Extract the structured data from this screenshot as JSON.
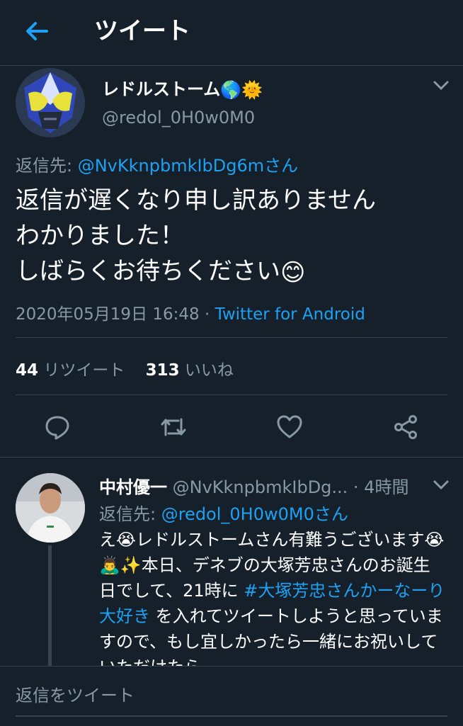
{
  "header": {
    "title": "ツイート"
  },
  "tweet": {
    "display_name": "レドルストーム",
    "name_emoji_1": "🌎",
    "name_emoji_2": "🌞",
    "handle": "@redol_0H0w0M0",
    "reply_label": "返信先: ",
    "reply_to": "@NvKknpbmkIbDg6mさん",
    "body_line1": "返信が遅くなり申し訳ありません",
    "body_line2": "わかりました！",
    "body_line3": "しばらくお待ちください",
    "body_emoji": "😊",
    "timestamp": "2020年05月19日 16:48",
    "separator": " · ",
    "source": "Twitter for Android",
    "retweet_count": "44",
    "retweet_label": " リツイート",
    "like_count": "313",
    "like_label": " いいね"
  },
  "reply": {
    "display_name": "中村優一",
    "handle": " @NvKknpbmkIbDg...",
    "time": " · 4時間",
    "reply_label": "返信先: ",
    "reply_to": "@redol_0H0w0M0さん",
    "text_a": "え😭レドルストームさん有難うございます😭🙇‍♂️✨本日、デネブの大塚芳忠さんのお誕生日でして、21時に ",
    "hashtag": "#大塚芳忠さんかーなーり大好き",
    "text_b": " を入れてツイートしようと思っていますので、もし宜しかったら一緒にお祝いしていただけたら"
  },
  "compose": {
    "placeholder": "返信をツイート"
  },
  "icons": [
    "back-arrow-icon",
    "chevron-down-icon",
    "reply-icon",
    "retweet-icon",
    "like-icon",
    "share-icon"
  ],
  "colors": {
    "background": "#15202b",
    "accent": "#1da1f2",
    "muted": "#8899a6",
    "divider": "#38444d"
  }
}
